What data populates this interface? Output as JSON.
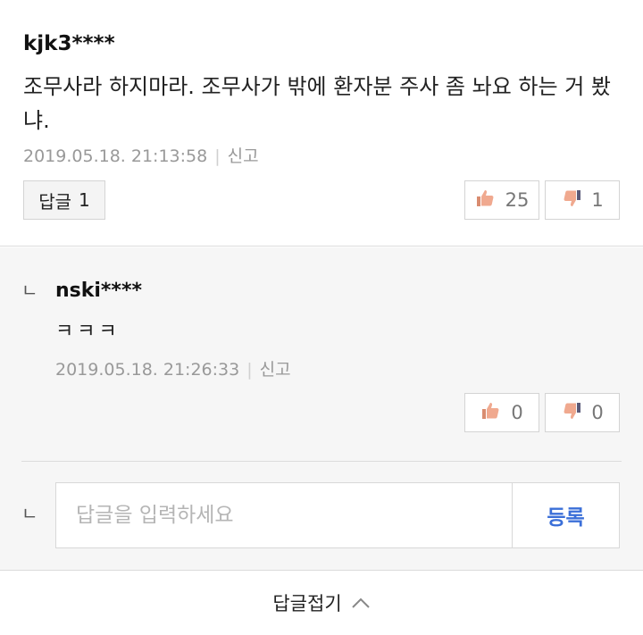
{
  "comment": {
    "username": "kjk3****",
    "text": "조무사라 하지마라. 조무사가 밖에 환자분 주사 좀 놔요 하는 거 봤냐.",
    "timestamp": "2019.05.18. 21:13:58",
    "report_label": "신고",
    "reply_button_label": "답글",
    "reply_count": "1",
    "like_count": "25",
    "dislike_count": "1"
  },
  "reply": {
    "marker": "ㄴ",
    "username": "nski****",
    "text": "ㅋㅋㅋ",
    "timestamp": "2019.05.18. 21:26:33",
    "report_label": "신고",
    "like_count": "0",
    "dislike_count": "0"
  },
  "reply_input": {
    "marker": "ㄴ",
    "placeholder": "답글을 입력하세요",
    "value": "",
    "submit_label": "등록"
  },
  "footer": {
    "collapse_label": "답글접기"
  },
  "colors": {
    "thumb_up": "#e8967a",
    "thumb_down": "#e8967a",
    "submit_text": "#3b6fd8"
  },
  "icons": {
    "like": "thumbs-up-icon",
    "dislike": "thumbs-down-icon",
    "collapse": "chevron-up-icon"
  }
}
